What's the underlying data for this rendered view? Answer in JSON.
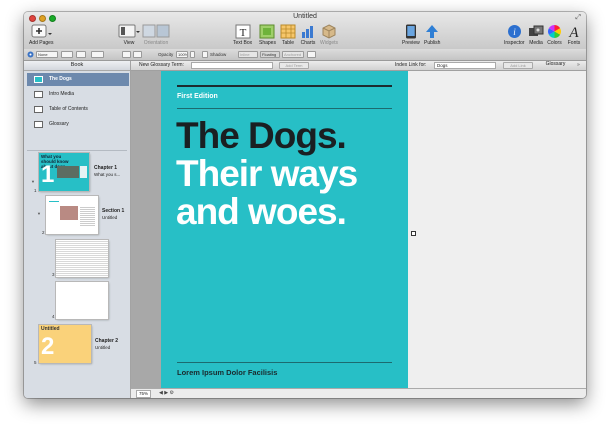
{
  "window": {
    "title": "Untitled"
  },
  "toolbar": {
    "add_pages": "Add Pages",
    "view": "View",
    "orientation": "Orientation",
    "text_box": "Text Box",
    "shapes": "Shapes",
    "table": "Table",
    "charts": "Charts",
    "widgets": "Widgets",
    "preview": "Preview",
    "publish": "Publish",
    "inspector": "Inspector",
    "media": "Media",
    "colors": "Colors",
    "fonts": "Fonts"
  },
  "formatbar": {
    "style": "None",
    "opacity_label": "Opacity",
    "opacity_value": "100%",
    "shadow_label": "Shadow",
    "inline": "Inline",
    "floating": "Floating",
    "anchored": "Anchored"
  },
  "sidebar": {
    "header": "Book",
    "items": [
      {
        "label": "The Dogs"
      },
      {
        "label": "Intro Media"
      },
      {
        "label": "Table of Contents"
      },
      {
        "label": "Glossary"
      }
    ],
    "pages": [
      {
        "num": "1",
        "title": "Chapter 1",
        "subtitle": "What you s...",
        "thumb_text": "What you should know about dogs.",
        "thumb_num": "1"
      },
      {
        "num": "2",
        "title": "Section 1",
        "subtitle": "Untitled"
      },
      {
        "num": "3"
      },
      {
        "num": "4"
      },
      {
        "num": "5",
        "title": "Chapter 2",
        "subtitle": "Untitled",
        "thumb_text": "Untitled",
        "thumb_num": "2"
      }
    ]
  },
  "glossary": {
    "new_term_label": "New Glossary Term:",
    "add_term": "Add Term",
    "index_link_label": "Index Link for:",
    "index_link_value": "Dogs",
    "add_link": "Add Link",
    "glossary_button": "Glossary"
  },
  "cover": {
    "edition": "First Edition",
    "title_line1": "The Dogs.",
    "title_line2": "Their ways",
    "title_line3": "and woes.",
    "author": "Lorem Ipsum Dolor Facilisis",
    "bg_color": "#27bfc6"
  },
  "status": {
    "zoom": "75%"
  }
}
